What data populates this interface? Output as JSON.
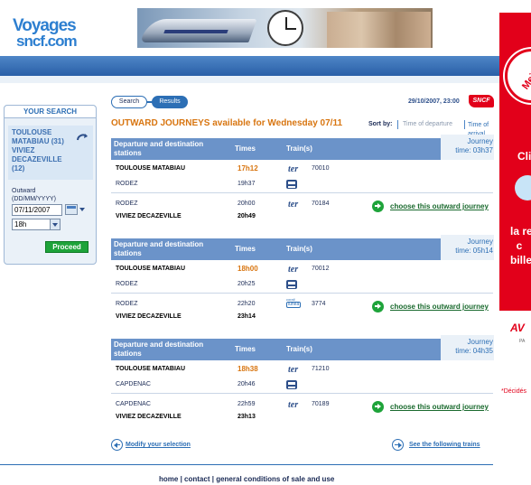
{
  "header": {
    "logo_line1": "Voyages",
    "logo_line2": "sncf.com"
  },
  "search": {
    "title": "YOUR SEARCH",
    "route": [
      "TOULOUSE",
      "MATABIAU (31)",
      "VIVIEZ",
      "DECAZEVILLE",
      "(12)"
    ],
    "outward_label": "Outward",
    "date_format": "(DD/MM/YYYY)",
    "date_value": "07/11/2007",
    "time_value": "18h",
    "proceed_label": "Proceed"
  },
  "steps": {
    "search": "Search",
    "results": "Results"
  },
  "datetime": "29/10/2007, 23:00",
  "sncf_label": "SNCF",
  "page_title": "OUTWARD JOURNEYS available for Wednesday 07/11",
  "sort": {
    "label": "Sort by:",
    "departure": "Time of departure",
    "arrival": "Time of arrival"
  },
  "columns": {
    "stations": "Departure and destination stations",
    "times": "Times",
    "trains": "Train(s)",
    "journey": "Journey"
  },
  "journeys": [
    {
      "duration": "time: 03h37",
      "legs": [
        {
          "from": "TOULOUSE MATABIAU",
          "dep": "17h12",
          "train_type": "ter",
          "train_no": "70010",
          "to": "RODEZ",
          "arr": "19h37",
          "to_type": "bus"
        },
        {
          "from": "RODEZ",
          "dep": "20h00",
          "train_type": "ter",
          "train_no": "70184",
          "to": "VIVIEZ DECAZEVILLE",
          "arr": "20h49"
        }
      ],
      "choose": "choose this outward journey"
    },
    {
      "duration": "time: 05h14",
      "legs": [
        {
          "from": "TOULOUSE MATABIAU",
          "dep": "18h00",
          "train_type": "ter",
          "train_no": "70012",
          "to": "RODEZ",
          "arr": "20h25",
          "to_type": "bus"
        },
        {
          "from": "RODEZ",
          "dep": "22h20",
          "train_type": "corail",
          "train_no": "3774",
          "to": "VIVIEZ DECAZEVILLE",
          "arr": "23h14"
        }
      ],
      "choose": "choose this outward journey"
    },
    {
      "duration": "time: 04h35",
      "legs": [
        {
          "from": "TOULOUSE MATABIAU",
          "dep": "18h38",
          "train_type": "ter",
          "train_no": "71210",
          "to": "CAPDENAC",
          "arr": "20h46",
          "to_type": "bus"
        },
        {
          "from": "CAPDENAC",
          "dep": "22h59",
          "train_type": "ter",
          "train_no": "70189",
          "to": "VIVIEZ DECAZEVILLE",
          "arr": "23h13"
        }
      ],
      "choose": "choose this outward journey"
    }
  ],
  "modify_label": "Modify your selection",
  "next_label": "See the following trains",
  "footer": {
    "home": "home",
    "contact": "contact",
    "conditions": "general conditions of sale and use"
  },
  "ad": {
    "circle": "Meilleur",
    "t1": "Cli",
    "t2": "la re\nc\nbille",
    "t3": "AV",
    "t3b": "PA",
    "t4": "*Décidés"
  },
  "colors": {
    "brand_blue": "#2d6fb5",
    "header_blue": "#6b93c9",
    "accent_orange": "#d87510",
    "go_green": "#1ea33a",
    "ad_red": "#e2001a"
  }
}
